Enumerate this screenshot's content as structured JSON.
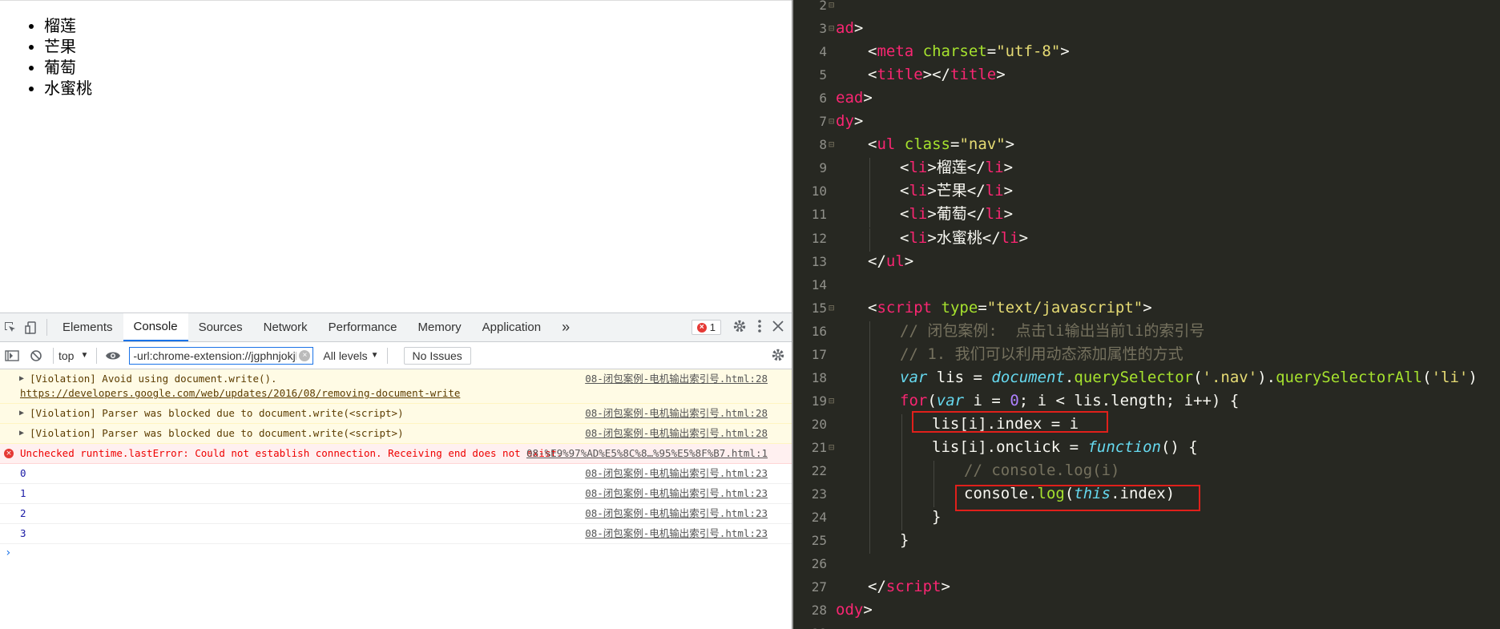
{
  "page": {
    "list_items": [
      "榴莲",
      "芒果",
      "葡萄",
      "水蜜桃"
    ]
  },
  "devtools": {
    "tabs": [
      "Elements",
      "Console",
      "Sources",
      "Network",
      "Performance",
      "Memory",
      "Application"
    ],
    "active_tab": "Console",
    "more_tabs_glyph": "»",
    "error_count": "1",
    "context_select": "top",
    "filter_value": "-url:chrome-extension://jgphnjokjhjlcnnajmfjlacjbjmpfbhb",
    "level_select": "All levels",
    "issues_label": "No Issues",
    "messages": [
      {
        "kind": "viol",
        "text_before": "[Violation] Avoid using document.write(). ",
        "link": "https://developers.google.com/web/updates/2016/08/removing-document-write",
        "src": "08-闭包案例-电机输出索引号.html:28"
      },
      {
        "kind": "viol",
        "text": "[Violation] Parser was blocked due to document.write(<script>)",
        "src": "08-闭包案例-电机输出索引号.html:28"
      },
      {
        "kind": "viol",
        "text": "[Violation] Parser was blocked due to document.write(<script>)",
        "src": "08-闭包案例-电机输出索引号.html:28"
      },
      {
        "kind": "err",
        "text": "Unchecked runtime.lastError: Could not establish connection. Receiving end does not exist.",
        "src": "08-%E9%97%AD%E5%8C%8…%95%E5%8F%B7.html:1"
      },
      {
        "kind": "log",
        "text": "0",
        "src": "08-闭包案例-电机输出索引号.html:23"
      },
      {
        "kind": "log",
        "text": "1",
        "src": "08-闭包案例-电机输出索引号.html:23"
      },
      {
        "kind": "log",
        "text": "2",
        "src": "08-闭包案例-电机输出索引号.html:23"
      },
      {
        "kind": "log",
        "text": "3",
        "src": "08-闭包案例-电机输出索引号.html:23"
      }
    ],
    "prompt_glyph": "›"
  },
  "editor": {
    "lines": [
      {
        "n": "2",
        "fold": "⊟",
        "tokens": []
      },
      {
        "n": "3",
        "fold": "⊟",
        "tokens": [
          [
            "tag",
            "ad"
          ],
          [
            "",
            "&gt;"
          ]
        ]
      },
      {
        "n": "4",
        "fold": "",
        "indent": 1,
        "tokens": [
          [
            "",
            "&lt;"
          ],
          [
            "tag",
            "meta"
          ],
          [
            "",
            " "
          ],
          [
            "attr",
            "charset"
          ],
          [
            "",
            "="
          ],
          [
            "str",
            "\"utf-8\""
          ],
          [
            "",
            "&gt;"
          ]
        ]
      },
      {
        "n": "5",
        "fold": "",
        "indent": 1,
        "tokens": [
          [
            "",
            "&lt;"
          ],
          [
            "tag",
            "title"
          ],
          [
            "",
            "&gt;&lt;/"
          ],
          [
            "tag",
            "title"
          ],
          [
            "",
            "&gt;"
          ]
        ]
      },
      {
        "n": "6",
        "fold": "",
        "tokens": [
          [
            "tag",
            "ead"
          ],
          [
            "",
            "&gt;"
          ]
        ]
      },
      {
        "n": "7",
        "fold": "⊟",
        "tokens": [
          [
            "tag",
            "dy"
          ],
          [
            "",
            "&gt;"
          ]
        ]
      },
      {
        "n": "8",
        "fold": "⊟",
        "indent": 1,
        "tokens": [
          [
            "",
            "&lt;"
          ],
          [
            "tag",
            "ul"
          ],
          [
            "",
            " "
          ],
          [
            "attr",
            "class"
          ],
          [
            "",
            "="
          ],
          [
            "str",
            "\"nav\""
          ],
          [
            "",
            "&gt;"
          ]
        ]
      },
      {
        "n": "9",
        "fold": "",
        "indent": 2,
        "tokens": [
          [
            "",
            "&lt;"
          ],
          [
            "tag",
            "li"
          ],
          [
            "",
            "&gt;榴莲&lt;/"
          ],
          [
            "tag",
            "li"
          ],
          [
            "",
            "&gt;"
          ]
        ]
      },
      {
        "n": "10",
        "fold": "",
        "indent": 2,
        "tokens": [
          [
            "",
            "&lt;"
          ],
          [
            "tag",
            "li"
          ],
          [
            "",
            "&gt;芒果&lt;/"
          ],
          [
            "tag",
            "li"
          ],
          [
            "",
            "&gt;"
          ]
        ]
      },
      {
        "n": "11",
        "fold": "",
        "indent": 2,
        "tokens": [
          [
            "",
            "&lt;"
          ],
          [
            "tag",
            "li"
          ],
          [
            "",
            "&gt;葡萄&lt;/"
          ],
          [
            "tag",
            "li"
          ],
          [
            "",
            "&gt;"
          ]
        ]
      },
      {
        "n": "12",
        "fold": "",
        "indent": 2,
        "tokens": [
          [
            "",
            "&lt;"
          ],
          [
            "tag",
            "li"
          ],
          [
            "",
            "&gt;水蜜桃&lt;/"
          ],
          [
            "tag",
            "li"
          ],
          [
            "",
            "&gt;"
          ]
        ]
      },
      {
        "n": "13",
        "fold": "",
        "indent": 1,
        "tokens": [
          [
            "",
            "&lt;/"
          ],
          [
            "tag",
            "ul"
          ],
          [
            "",
            "&gt;"
          ]
        ]
      },
      {
        "n": "14",
        "fold": "",
        "tokens": []
      },
      {
        "n": "15",
        "fold": "⊟",
        "indent": 1,
        "tokens": [
          [
            "",
            "&lt;"
          ],
          [
            "tag",
            "script"
          ],
          [
            "",
            " "
          ],
          [
            "attr",
            "type"
          ],
          [
            "",
            "="
          ],
          [
            "str",
            "\"text/javascript\""
          ],
          [
            "",
            "&gt;"
          ]
        ]
      },
      {
        "n": "16",
        "fold": "",
        "indent": 2,
        "tokens": [
          [
            "cmt",
            "// 闭包案例:  点击li输出当前li的索引号"
          ]
        ]
      },
      {
        "n": "17",
        "fold": "",
        "indent": 2,
        "tokens": [
          [
            "cmt",
            "// 1. 我们可以利用动态添加属性的方式"
          ]
        ]
      },
      {
        "n": "18",
        "fold": "",
        "indent": 2,
        "tokens": [
          [
            "ital",
            "var"
          ],
          [
            "",
            " lis = "
          ],
          [
            "ital",
            "document"
          ],
          [
            "",
            "."
          ],
          [
            "meth",
            "querySelector"
          ],
          [
            "",
            "("
          ],
          [
            "str",
            "'.nav'"
          ],
          [
            "",
            ")."
          ],
          [
            "meth",
            "querySelectorAll"
          ],
          [
            "",
            "("
          ],
          [
            "str",
            "'li'"
          ],
          [
            "",
            ")"
          ]
        ]
      },
      {
        "n": "19",
        "fold": "⊟",
        "indent": 2,
        "tokens": [
          [
            "kw",
            "for"
          ],
          [
            "",
            "("
          ],
          [
            "ital",
            "var"
          ],
          [
            "",
            " i = "
          ],
          [
            "num",
            "0"
          ],
          [
            "",
            "; i &lt; lis.length; i++) {"
          ]
        ]
      },
      {
        "n": "20",
        "fold": "",
        "indent": 3,
        "tokens": [
          [
            "",
            "lis[i].index = i"
          ]
        ]
      },
      {
        "n": "21",
        "fold": "⊟",
        "indent": 3,
        "tokens": [
          [
            "",
            "lis[i].onclick = "
          ],
          [
            "fn",
            "function"
          ],
          [
            "",
            "() {"
          ]
        ]
      },
      {
        "n": "22",
        "fold": "",
        "indent": 4,
        "tokens": [
          [
            "cmt",
            "// console.log(i)"
          ]
        ]
      },
      {
        "n": "23",
        "fold": "",
        "indent": 4,
        "tokens": [
          [
            "",
            "console."
          ],
          [
            "meth",
            "log"
          ],
          [
            "",
            "("
          ],
          [
            "ital",
            "this"
          ],
          [
            "",
            ".index)"
          ]
        ]
      },
      {
        "n": "24",
        "fold": "",
        "indent": 3,
        "tokens": [
          [
            "",
            "}"
          ]
        ]
      },
      {
        "n": "25",
        "fold": "",
        "indent": 2,
        "tokens": [
          [
            "",
            "}"
          ]
        ]
      },
      {
        "n": "26",
        "fold": "",
        "tokens": []
      },
      {
        "n": "27",
        "fold": "",
        "indent": 1,
        "tokens": [
          [
            "",
            "&lt;/"
          ],
          [
            "tag",
            "script"
          ],
          [
            "",
            "&gt;"
          ]
        ]
      },
      {
        "n": "28",
        "fold": "",
        "tokens": [
          [
            "tag",
            "ody"
          ],
          [
            "",
            "&gt;"
          ]
        ]
      },
      {
        "n": "29",
        "fold": "",
        "tokens": []
      }
    ]
  }
}
